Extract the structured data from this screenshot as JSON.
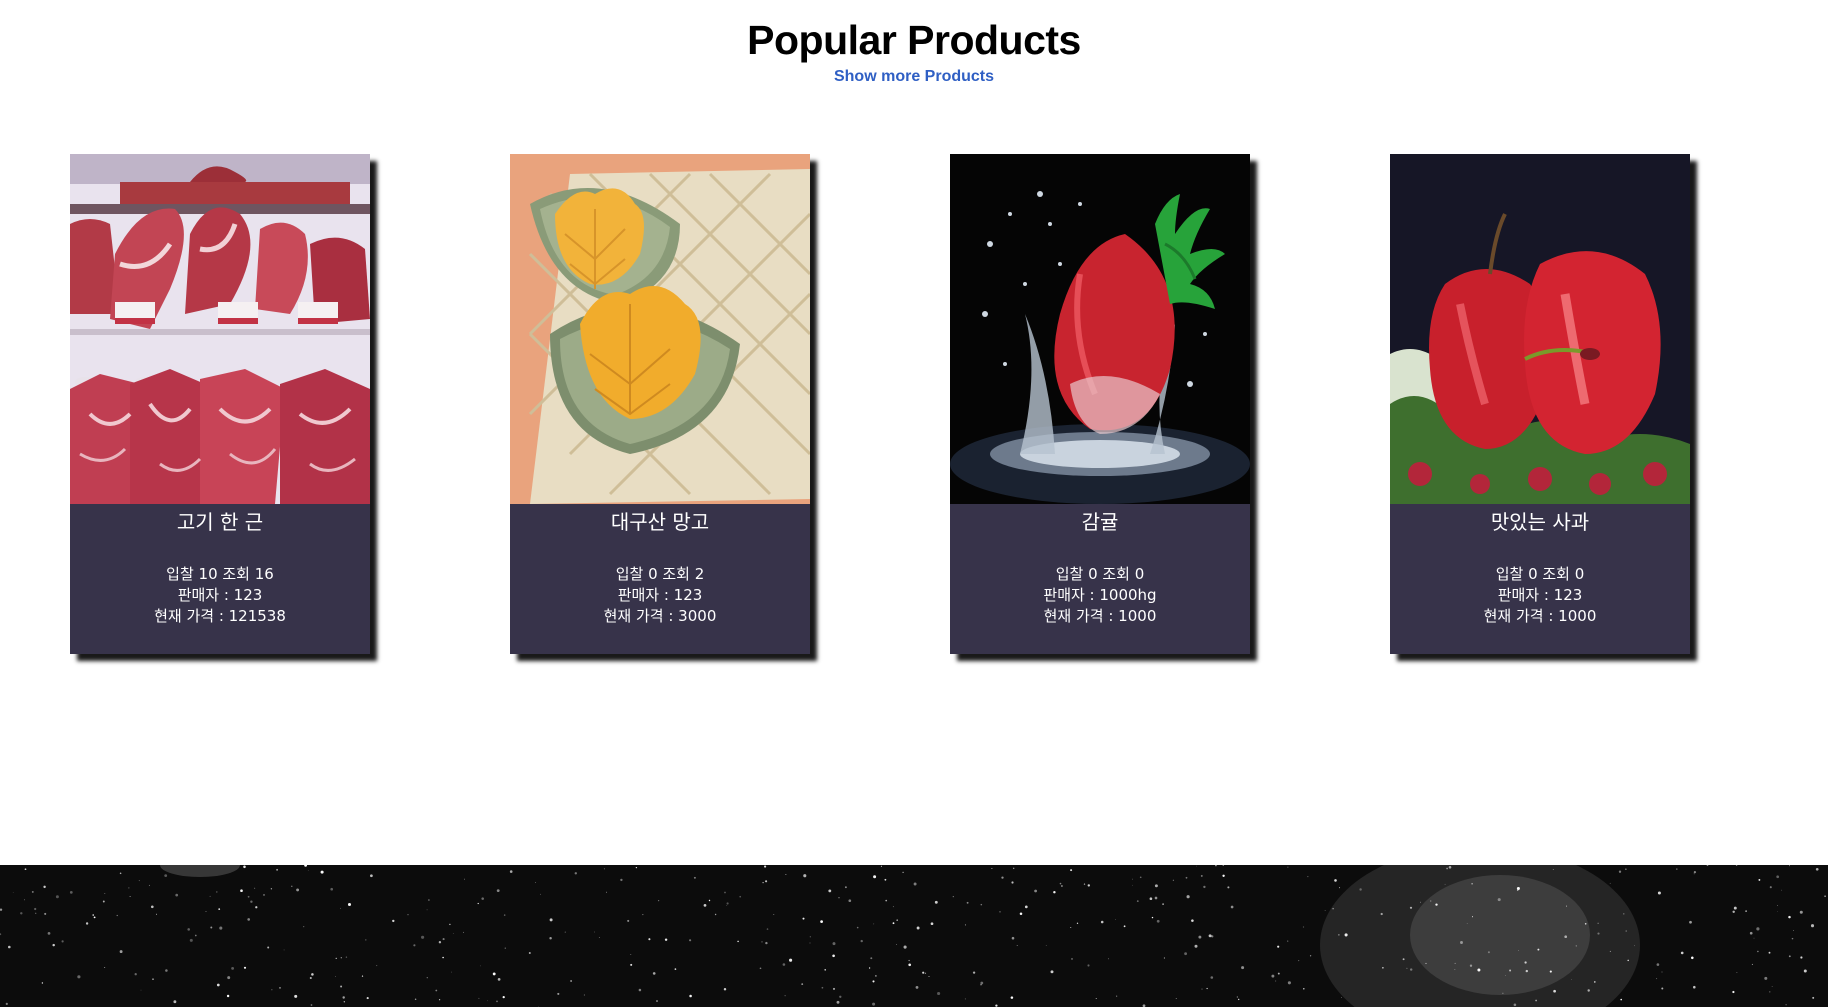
{
  "header": {
    "title": "Popular Products",
    "more_link": "Show more Products",
    "link_color": "#2f5fc4"
  },
  "products": [
    {
      "name": "고기 한 근",
      "image_icon": "raw-meat-display-image",
      "bids_views": "입찰 10 조회 16",
      "seller": "판매자 : 123",
      "price": "현재 가격 : 121538"
    },
    {
      "name": "대구산 망고",
      "image_icon": "sliced-mango-image",
      "bids_views": "입찰 0 조회 2",
      "seller": "판매자 : 123",
      "price": "현재 가격 : 3000"
    },
    {
      "name": "감귤",
      "image_icon": "strawberry-splash-image",
      "bids_views": "입찰 0 조회 0",
      "seller": "판매자 : 1000hg",
      "price": "현재 가격 : 1000"
    },
    {
      "name": "맛있는 사과",
      "image_icon": "red-apples-image",
      "bids_views": "입찰 0 조회 0",
      "seller": "판매자 : 123",
      "price": "현재 가격 : 1000"
    }
  ],
  "colors": {
    "card_background": "#37334a",
    "footer_background": "#0c0c0c"
  }
}
